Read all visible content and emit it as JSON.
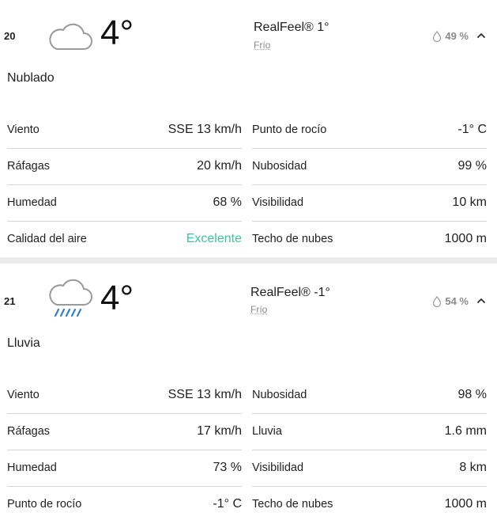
{
  "hours": [
    {
      "hour": "20",
      "icon": "cloud-icon",
      "temp": "4°",
      "realfeel": "RealFeel® 1°",
      "feel_phrase": "Frío",
      "precip": "49 %",
      "condition": "Nublado",
      "left": [
        {
          "label": "Viento",
          "value": "SSE 13 km/h"
        },
        {
          "label": "Ráfagas",
          "value": "20 km/h"
        },
        {
          "label": "Humedad",
          "value": "68 %"
        },
        {
          "label": "Calidad del aire",
          "value": "Excelente"
        }
      ],
      "right": [
        {
          "label": "Punto de rocío",
          "value": "-1° C"
        },
        {
          "label": "Nubosidad",
          "value": "99 %"
        },
        {
          "label": "Visibilidad",
          "value": "10 km"
        },
        {
          "label": "Techo de nubes",
          "value": "1000 m"
        }
      ]
    },
    {
      "hour": "21",
      "icon": "rain-cloud-icon",
      "temp": "4°",
      "realfeel": "RealFeel® -1°",
      "feel_phrase": "Frío",
      "precip": "54 %",
      "condition": "Lluvia",
      "left": [
        {
          "label": "Viento",
          "value": "SSE 13 km/h"
        },
        {
          "label": "Ráfagas",
          "value": "17 km/h"
        },
        {
          "label": "Humedad",
          "value": "73 %"
        },
        {
          "label": "Punto de rocío",
          "value": "-1° C"
        }
      ],
      "right": [
        {
          "label": "Nubosidad",
          "value": "98 %"
        },
        {
          "label": "Lluvia",
          "value": "1.6 mm"
        },
        {
          "label": "Visibilidad",
          "value": "8 km"
        },
        {
          "label": "Techo de nubes",
          "value": "1000 m"
        }
      ]
    }
  ],
  "colors": {
    "air_quality_good": "#3fc49a",
    "rain": "#2f7fd1",
    "separator": "#ececec"
  }
}
